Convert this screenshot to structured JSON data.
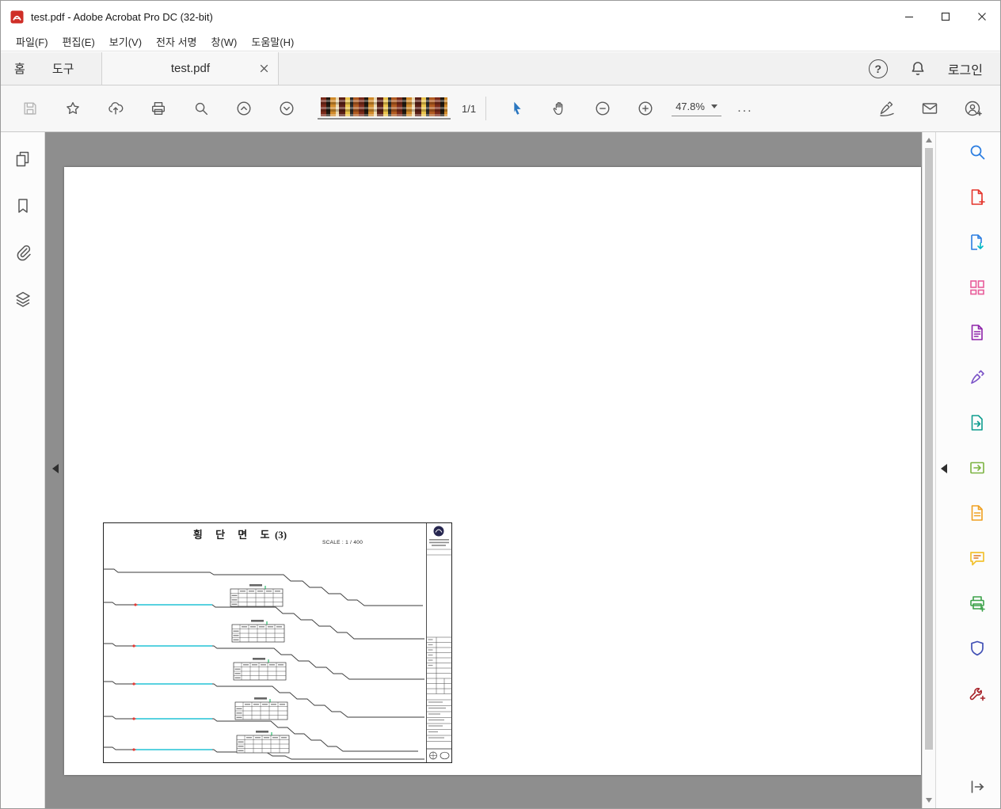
{
  "window": {
    "title": "test.pdf - Adobe Acrobat Pro DC (32-bit)"
  },
  "menubar": {
    "items": [
      "파일(F)",
      "편집(E)",
      "보기(V)",
      "전자 서명",
      "창(W)",
      "도움말(H)"
    ]
  },
  "tabbar": {
    "home": "홈",
    "tools": "도구",
    "document_tab": "test.pdf",
    "help_glyph": "?",
    "login": "로그인"
  },
  "toolbar": {
    "page_indicator": "1/1",
    "zoom_value": "47.8%",
    "more_label": "..."
  },
  "drawing": {
    "title": "횡     단     면     도  (3)",
    "scale": "SCALE : 1 / 400"
  },
  "colors": {
    "acrobat_red": "#cf2e27",
    "selection_blue": "#2b77c0",
    "document_background": "#8e8e8e",
    "cyan_highlight": "#22c3d6"
  }
}
